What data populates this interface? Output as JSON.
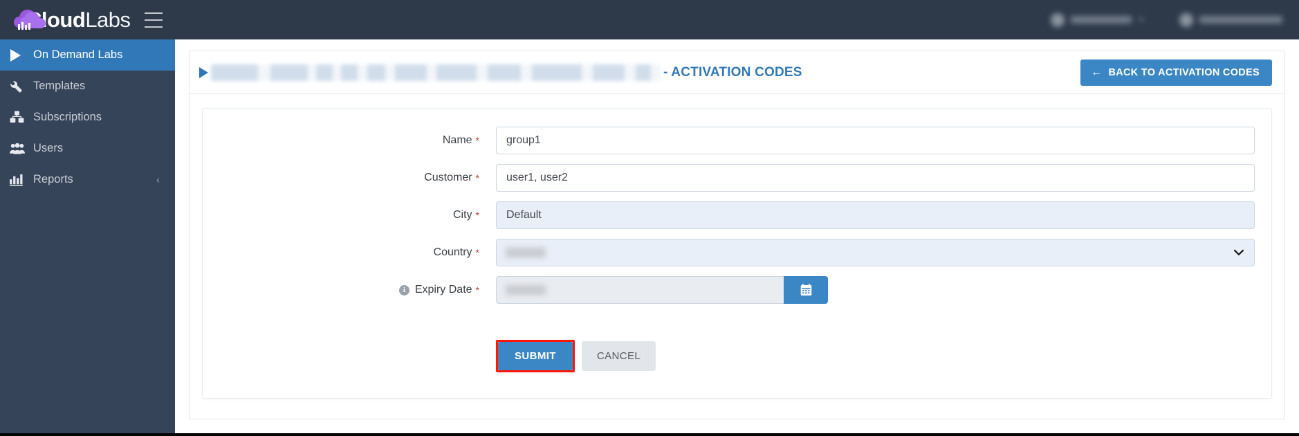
{
  "topbar": {
    "logo_bold": "Cloud",
    "logo_light": "Labs",
    "menu_icon": "hamburger-icon",
    "right_items": [
      {
        "icon": "user-avatar-icon",
        "label": "",
        "redacted": true
      },
      {
        "icon": "user-avatar-icon",
        "label": "",
        "redacted": true
      }
    ]
  },
  "sidebar": {
    "items": [
      {
        "label": "On Demand Labs",
        "icon": "play-triangle-icon",
        "active": true,
        "chevron": ""
      },
      {
        "label": "Templates",
        "icon": "wrench-icon",
        "active": false,
        "chevron": ""
      },
      {
        "label": "Subscriptions",
        "icon": "boxes-icon",
        "active": false,
        "chevron": ""
      },
      {
        "label": "Users",
        "icon": "users-icon",
        "active": false,
        "chevron": ""
      },
      {
        "label": "Reports",
        "icon": "bar-chart-icon",
        "active": false,
        "chevron": "‹"
      }
    ]
  },
  "panel": {
    "header": {
      "bullet_icon": "triangle-right-icon",
      "redacted_title": "",
      "title": "- ACTIVATION CODES",
      "back_button": {
        "label": "BACK TO ACTIVATION CODES",
        "icon": "arrow-left-icon",
        "glyph": "←"
      }
    }
  },
  "form": {
    "fields": [
      {
        "label": "Name",
        "required": "*",
        "value": "group1",
        "placeholder": "",
        "type": "text",
        "state": "normal"
      },
      {
        "label": "Customer",
        "required": "*",
        "value": "user1, user2",
        "placeholder": "",
        "type": "text",
        "state": "normal"
      },
      {
        "label": "City",
        "required": "*",
        "value": "Default",
        "placeholder": "",
        "type": "text",
        "state": "filled"
      },
      {
        "label": "Country",
        "required": "*",
        "value": "",
        "placeholder": "",
        "type": "select",
        "state": "filled",
        "caret": "⌄"
      },
      {
        "label": "Expiry Date",
        "required": "*",
        "value": "",
        "placeholder": "",
        "type": "date",
        "state": "disabled",
        "info_icon": "info-circle-icon",
        "info_glyph": "i",
        "calendar_icon": "calendar-icon",
        "calendar_glyph": "Ὄ5"
      }
    ],
    "buttons": {
      "submit": "SUBMIT",
      "cancel": "CANCEL"
    }
  },
  "colors": {
    "topbar_bg": "#2e3a4a",
    "sidebar_bg": "#36445a",
    "accent_blue": "#3178b8",
    "button_blue": "#3b86c4",
    "highlight_red": "#fc1708",
    "filled_field": "#e9eff8",
    "required_red": "#c0392b"
  }
}
